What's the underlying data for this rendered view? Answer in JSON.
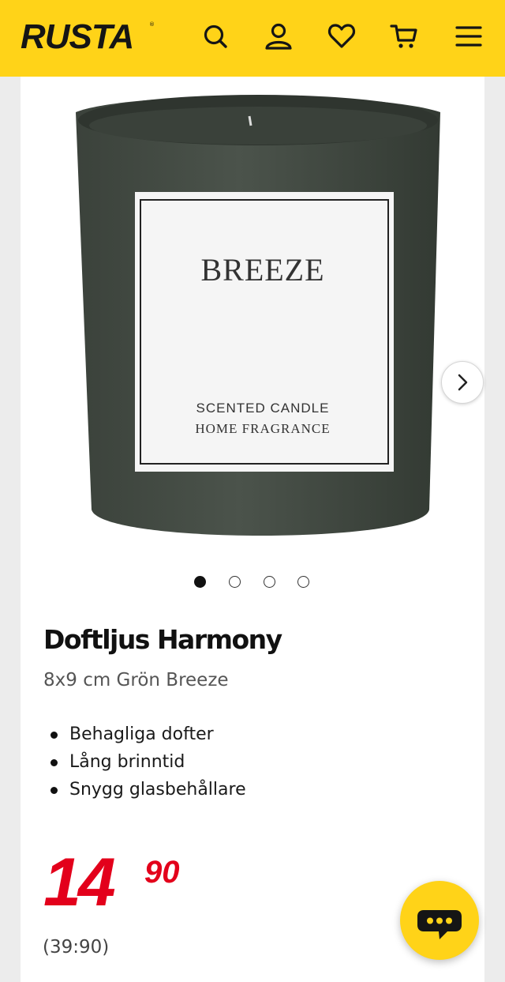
{
  "header": {
    "logo_text": "RUSTA",
    "logo_reg": "®",
    "icons": [
      "search-icon",
      "account-icon",
      "heart-icon",
      "cart-icon",
      "menu-icon"
    ],
    "background_color": "#ffd318"
  },
  "product": {
    "image": {
      "label_brand": "BREEZE",
      "label_line1": "SCENTED CANDLE",
      "label_line2": "HOME FRAGRANCE"
    },
    "gallery": {
      "image_count": 4,
      "active_index": 0
    },
    "title": "Doftljus Harmony",
    "subtitle": "8x9 cm Grön Breeze",
    "features": [
      "Behagliga dofter",
      "Lång brinntid",
      "Snygg glasbehållare"
    ],
    "price": {
      "whole": "14",
      "decimals": "90",
      "compare": "(39:90)",
      "color": "#e3001b"
    }
  },
  "chat": {
    "icon": "chat-icon"
  }
}
